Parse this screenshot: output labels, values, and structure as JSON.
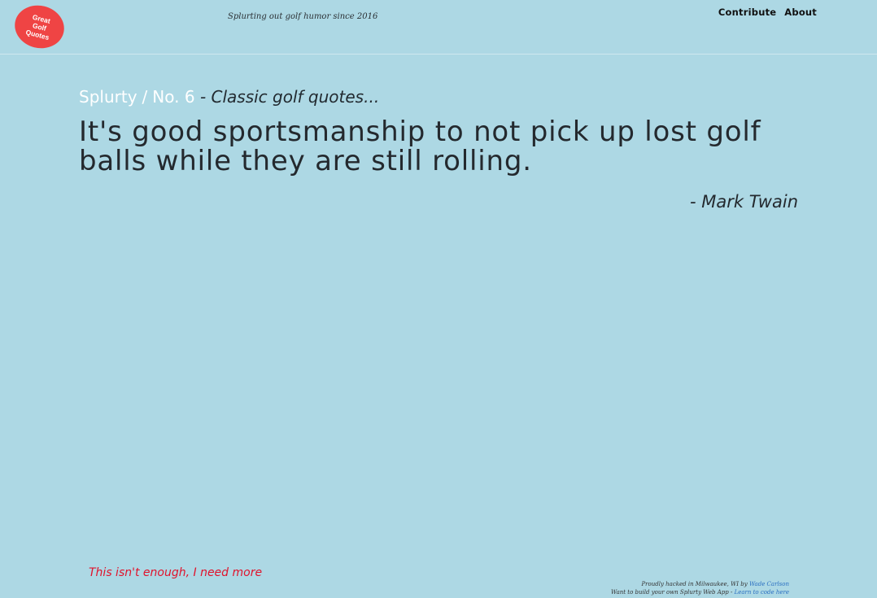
{
  "header": {
    "logo_lines": [
      "Great",
      "Golf",
      "Quotes"
    ],
    "tagline": "Splurting out golf humor since 2016",
    "nav": [
      "Contribute",
      "About"
    ]
  },
  "breadcrumb": {
    "site": "Splurty",
    "separator": "/",
    "number": "No. 6",
    "description": "- Classic golf quotes..."
  },
  "quote": {
    "text": "It's good sportsmanship to not pick up lost golf balls while they are still rolling.",
    "author": "- Mark Twain"
  },
  "more_link": "This isn't enough, I need more",
  "footer": {
    "line1_text": "Proudly hacked in Milwaukee, WI by ",
    "line1_link": "Wade Carlson",
    "line2_text": "Want to build your own Splurty Web App - ",
    "line2_link": "Learn to code here"
  },
  "colors": {
    "background": "#add8e4",
    "logo": "#ef4444",
    "more_link": "#e0132c",
    "footer_link": "#2a6fc1"
  }
}
